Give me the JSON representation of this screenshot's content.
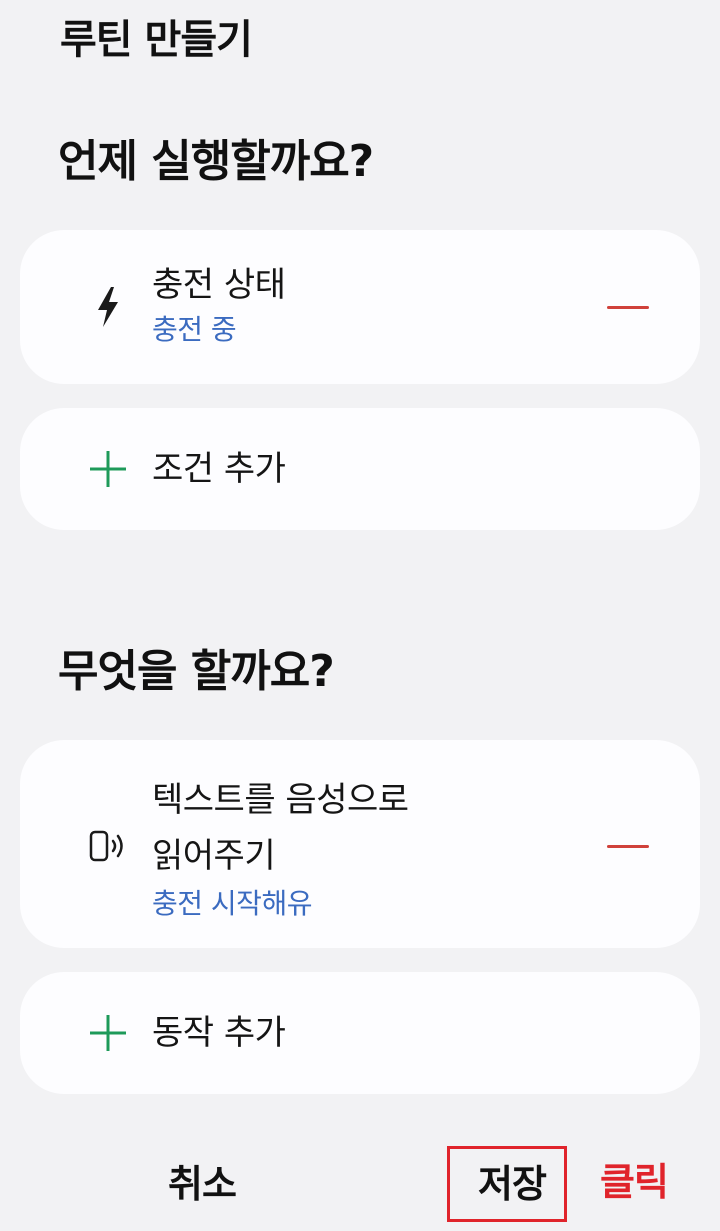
{
  "header": {
    "title": "루틴 만들기"
  },
  "conditions": {
    "section_title": "언제 실행할까요?",
    "items": [
      {
        "label": "충전 상태",
        "sub": "충전 중",
        "icon": "lightning-icon"
      }
    ],
    "add_label": "조건 추가"
  },
  "actions": {
    "section_title": "무엇을 할까요?",
    "items": [
      {
        "label_line1": "텍스트를 음성으로",
        "label_line2": "읽어주기",
        "sub": "충전 시작해유",
        "icon": "speaker-sound-icon"
      }
    ],
    "add_label": "동작 추가"
  },
  "footer": {
    "cancel_label": "취소",
    "save_label": "저장"
  },
  "annotation": {
    "click_label": "클릭"
  },
  "colors": {
    "accent_blue": "#3b6bc0",
    "remove_red": "#d0413b",
    "add_green": "#1e9a5a",
    "annotation_red": "#e0242b",
    "background": "#f2f2f4",
    "card": "#fdfdff"
  }
}
